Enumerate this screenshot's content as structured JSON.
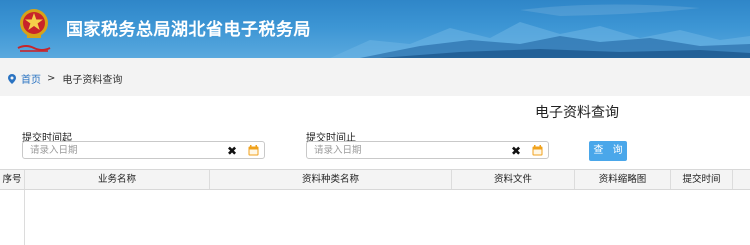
{
  "header": {
    "site_title": "国家税务总局湖北省电子税务局"
  },
  "breadcrumb": {
    "home": "首页",
    "separator": ">",
    "current": "电子资料查询"
  },
  "page": {
    "title": "电子资料查询"
  },
  "filters": {
    "start": {
      "label": "提交时间起",
      "placeholder": "请录入日期",
      "value": ""
    },
    "end": {
      "label": "提交时间止",
      "placeholder": "请录入日期",
      "value": ""
    },
    "clear_glyph": "✖",
    "calendar_icon": "calendar-icon"
  },
  "actions": {
    "query": "查 询"
  },
  "table": {
    "columns": [
      "序号",
      "业务名称",
      "资料种类名称",
      "资料文件",
      "资料缩略图",
      "提交时间"
    ],
    "rows": []
  },
  "colors": {
    "banner": "#3a91d2",
    "link": "#2a73c2",
    "button": "#4aa7ea",
    "calendar": "#f0a21c"
  }
}
